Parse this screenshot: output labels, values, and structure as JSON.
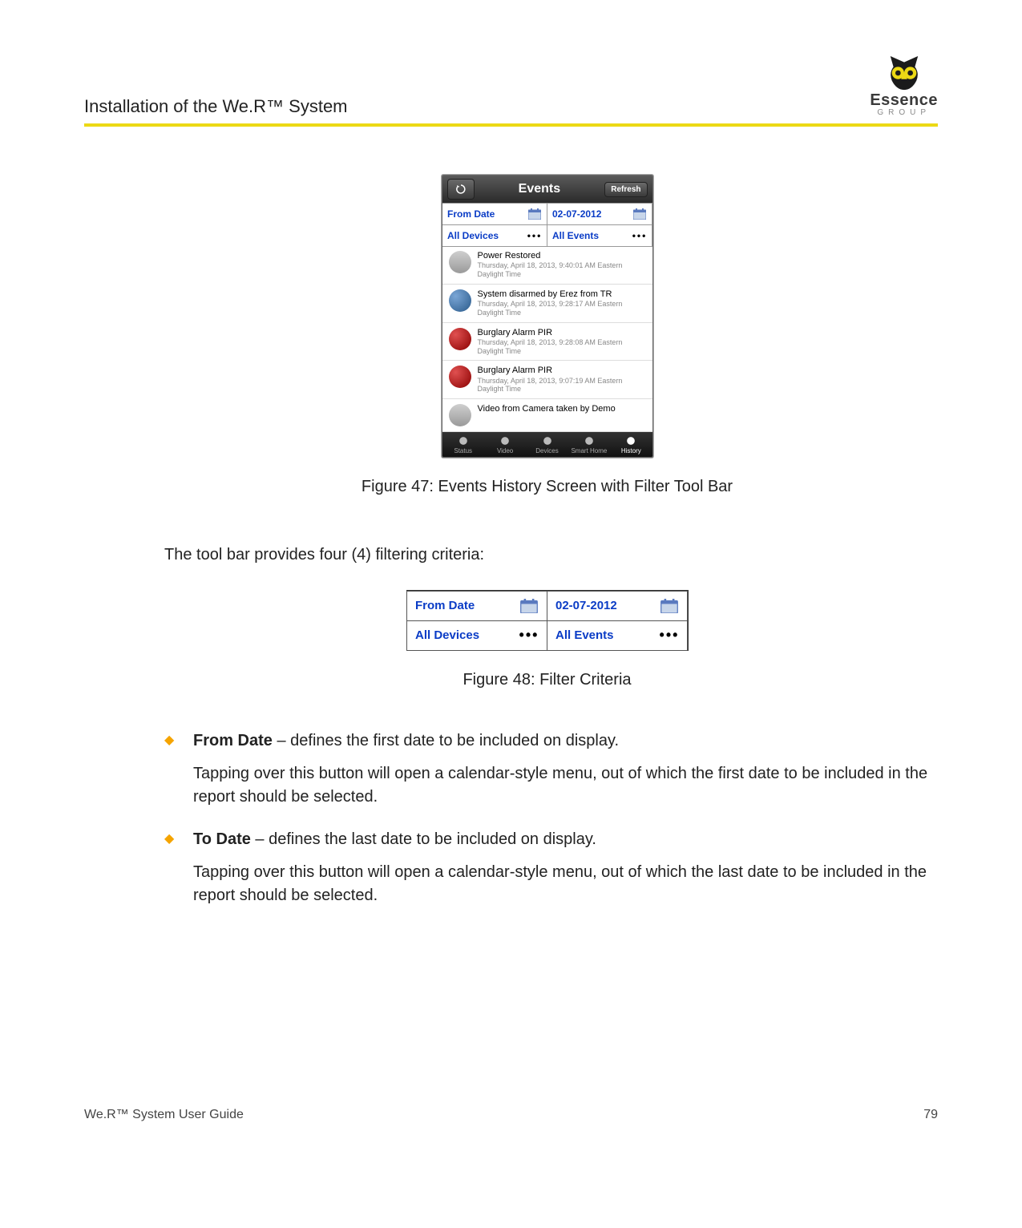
{
  "header": {
    "section_title": "Installation of the We.R™ System",
    "logo_text": "Essence",
    "logo_sub": "GROUP"
  },
  "figure1": {
    "caption": "Figure 47: Events History Screen with Filter Tool Bar",
    "titlebar": {
      "title": "Events",
      "refresh": "Refresh"
    },
    "filters": {
      "from_date": "From Date",
      "to_date": "02-07-2012",
      "devices": "All Devices",
      "events": "All Events"
    },
    "events": [
      {
        "icon": "gray",
        "title": "Power Restored",
        "sub": "Thursday, April 18, 2013, 9:40:01 AM Eastern Daylight Time"
      },
      {
        "icon": "blue",
        "title": "System disarmed by Erez from TR",
        "sub": "Thursday, April 18, 2013, 9:28:17 AM Eastern Daylight Time"
      },
      {
        "icon": "red",
        "title": "Burglary Alarm PIR",
        "sub": "Thursday, April 18, 2013, 9:28:08 AM Eastern Daylight Time"
      },
      {
        "icon": "red",
        "title": "Burglary Alarm PIR",
        "sub": "Thursday, April 18, 2013, 9:07:19 AM Eastern Daylight Time"
      },
      {
        "icon": "gray",
        "title": "Video from Camera taken by Demo",
        "sub": ""
      }
    ],
    "tabs": [
      "Status",
      "Video",
      "Devices",
      "Smart Home",
      "History"
    ]
  },
  "figure2": {
    "caption": "Figure 48: Filter Criteria",
    "filters": {
      "from_date": "From Date",
      "to_date": "02-07-2012",
      "devices": "All Devices",
      "events": "All Events"
    }
  },
  "body": {
    "intro": "The tool bar provides four (4) filtering criteria:",
    "bullets": [
      {
        "bold": "From Date",
        "rest": " – defines the first date to be included on display.",
        "para": "Tapping over this button will open a calendar-style menu, out of which the first date to be included in the report should be selected."
      },
      {
        "bold": "To Date",
        "rest": " – defines the last date to be included on display.",
        "para": "Tapping over this button will open a calendar-style menu, out of which the last date to be included in the report should be selected."
      }
    ]
  },
  "footer": {
    "left": "We.R™ System User Guide",
    "right": "79"
  }
}
